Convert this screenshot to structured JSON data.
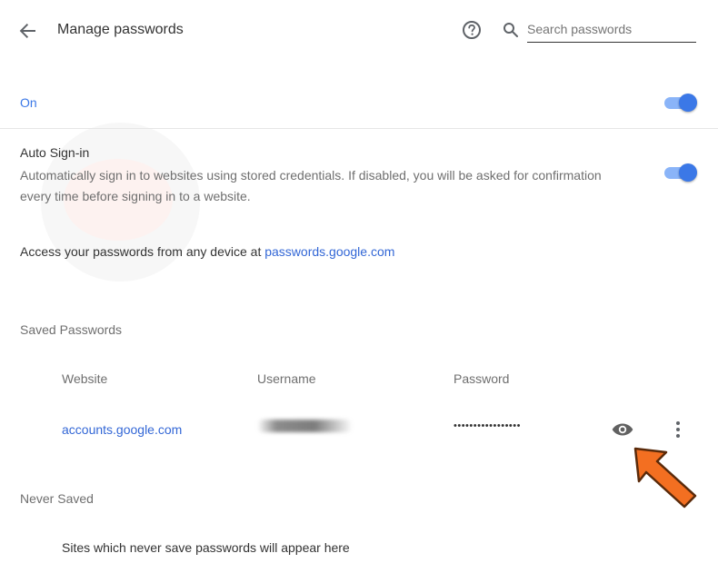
{
  "header": {
    "title": "Manage passwords",
    "search_placeholder": "Search passwords"
  },
  "on_toggle": {
    "label": "On",
    "checked": true
  },
  "auto_signin": {
    "title": "Auto Sign-in",
    "description": "Automatically sign in to websites using stored credentials. If disabled, you will be asked for confirmation every time before signing in to a website.",
    "checked": true
  },
  "access": {
    "text": "Access your passwords from any device at ",
    "link": "passwords.google.com"
  },
  "saved_passwords": {
    "heading": "Saved Passwords",
    "columns": [
      "Website",
      "Username",
      "Password"
    ],
    "rows": [
      {
        "website": "accounts.google.com",
        "password_mask": "•••••••••••••••••"
      }
    ]
  },
  "never_saved": {
    "heading": "Never Saved",
    "empty_text": "Sites which never save passwords will appear here"
  },
  "colors": {
    "accent": "#3b78e7",
    "link": "#3367d6",
    "annotation_arrow": "#f36f21"
  },
  "icons": {
    "back": "arrow-left-icon",
    "help": "help-circle-icon",
    "search": "search-icon",
    "show_password": "eye-icon",
    "more": "more-vert-icon"
  }
}
